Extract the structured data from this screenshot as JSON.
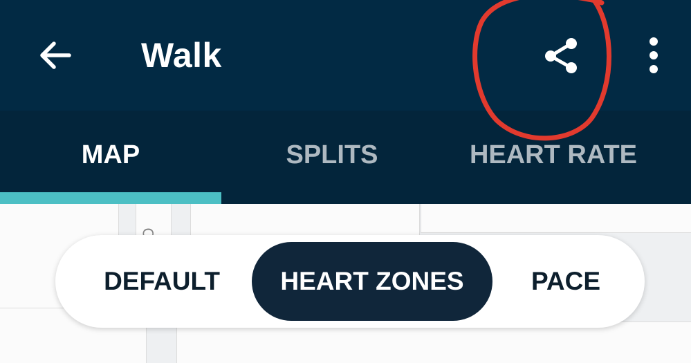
{
  "app_bar": {
    "title": "Walk",
    "back_icon": "arrow-left-icon",
    "share_icon": "share-icon",
    "more_icon": "more-vertical-icon",
    "background": "#022a44",
    "annotation_color": "#e23a2e"
  },
  "tabs": {
    "items": [
      {
        "label": "MAP",
        "selected": true
      },
      {
        "label": "SPLITS",
        "selected": false
      },
      {
        "label": "HEART RATE",
        "selected": false
      }
    ],
    "indicator_color": "#4cbfc4",
    "background": "#03253b"
  },
  "map_modes": {
    "options": [
      {
        "label": "DEFAULT",
        "selected": false
      },
      {
        "label": "HEART ZONES",
        "selected": true
      },
      {
        "label": "PACE",
        "selected": false
      }
    ],
    "selected_color": "#10263a"
  },
  "map": {
    "street_label": "O"
  }
}
